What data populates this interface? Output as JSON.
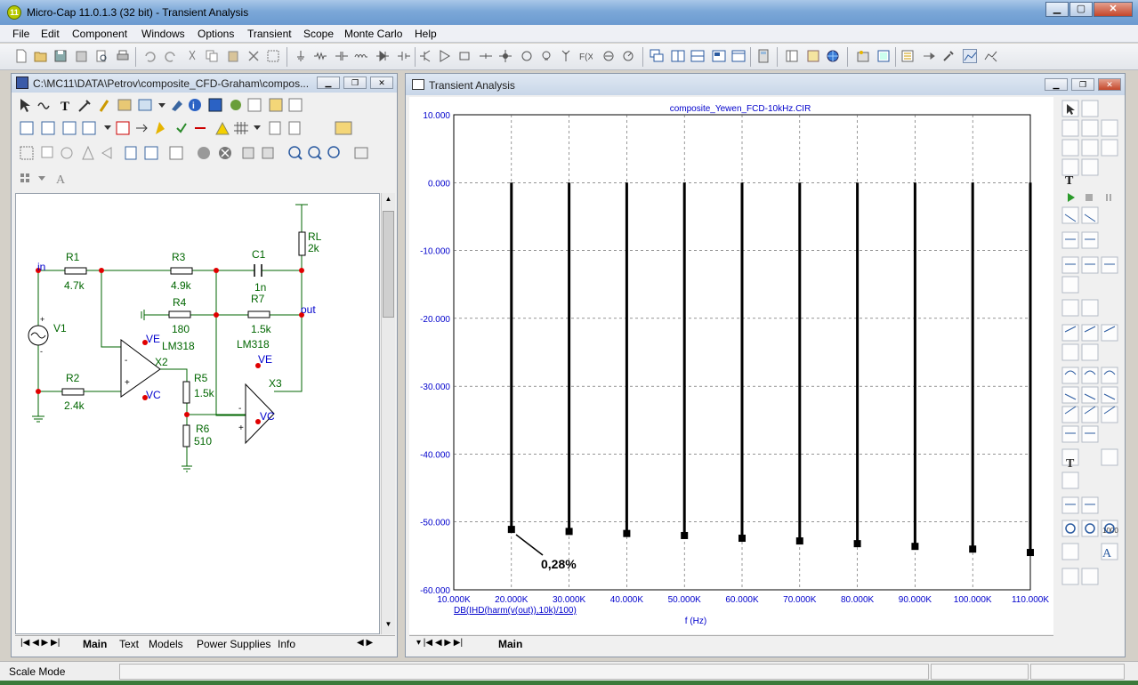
{
  "window": {
    "title": "Micro-Cap 11.0.1.3 (32 bit) - Transient Analysis",
    "app_icon": "11"
  },
  "menu": [
    "File",
    "Edit",
    "Component",
    "Windows",
    "Options",
    "Transient",
    "Scope",
    "Monte Carlo",
    "Help"
  ],
  "schematic": {
    "title": "C:\\MC11\\DATA\\Petrov\\composite_CFD-Graham\\compos...",
    "tabs": [
      "Main",
      "Text",
      "Models",
      "Power Supplies",
      "Info"
    ],
    "components": {
      "r1": {
        "name": "R1",
        "value": "4.7k"
      },
      "r2": {
        "name": "R2",
        "value": "2.4k"
      },
      "r3": {
        "name": "R3",
        "value": "4.9k"
      },
      "r4": {
        "name": "R4",
        "value": "180"
      },
      "r5": {
        "name": "R5",
        "value": "1.5k"
      },
      "r6": {
        "name": "R6",
        "value": "510"
      },
      "r7": {
        "name": "R7",
        "value": "1.5k"
      },
      "rl": {
        "name": "RL",
        "value": "2k"
      },
      "c1": {
        "name": "C1",
        "value": "1n"
      },
      "v1": {
        "name": "V1"
      },
      "x2": {
        "name": "X2",
        "model": "LM318"
      },
      "x3": {
        "name": "X3",
        "model": "LM318"
      }
    },
    "nodes": {
      "in": "in",
      "out": "out",
      "ve": "VE",
      "vc": "VC"
    },
    "pins": {
      "minus": "-",
      "plus": "+"
    }
  },
  "analysis": {
    "title": "Transient Analysis",
    "tab": "Main",
    "status": "Scale Mode",
    "annotation": "0,28%"
  },
  "chart_data": {
    "type": "bar",
    "title": "composite_Yewen_FCD-10kHz.CIR",
    "xlabel": "f (Hz)",
    "ylabel": "DB(IHD(harm(v(out)),10k)/100)",
    "xlim": [
      10000,
      110000
    ],
    "ylim": [
      -60,
      10
    ],
    "grid": true,
    "x_ticks": [
      "10.000K",
      "20.000K",
      "30.000K",
      "40.000K",
      "50.000K",
      "60.000K",
      "70.000K",
      "80.000K",
      "90.000K",
      "100.000K",
      "110.000K"
    ],
    "y_ticks": [
      "10.000",
      "0.000",
      "-10.000",
      "-20.000",
      "-30.000",
      "-40.000",
      "-50.000",
      "-60.000"
    ],
    "series": [
      {
        "x": [
          20000,
          30000,
          40000,
          50000,
          60000,
          70000,
          80000,
          90000,
          100000,
          110000
        ],
        "values": [
          -51.1,
          -51.4,
          -51.7,
          -52.0,
          -52.4,
          -52.8,
          -53.2,
          -53.6,
          -54.0,
          -54.5
        ]
      }
    ],
    "color": "#000000",
    "tick_color": "#0000cc"
  }
}
